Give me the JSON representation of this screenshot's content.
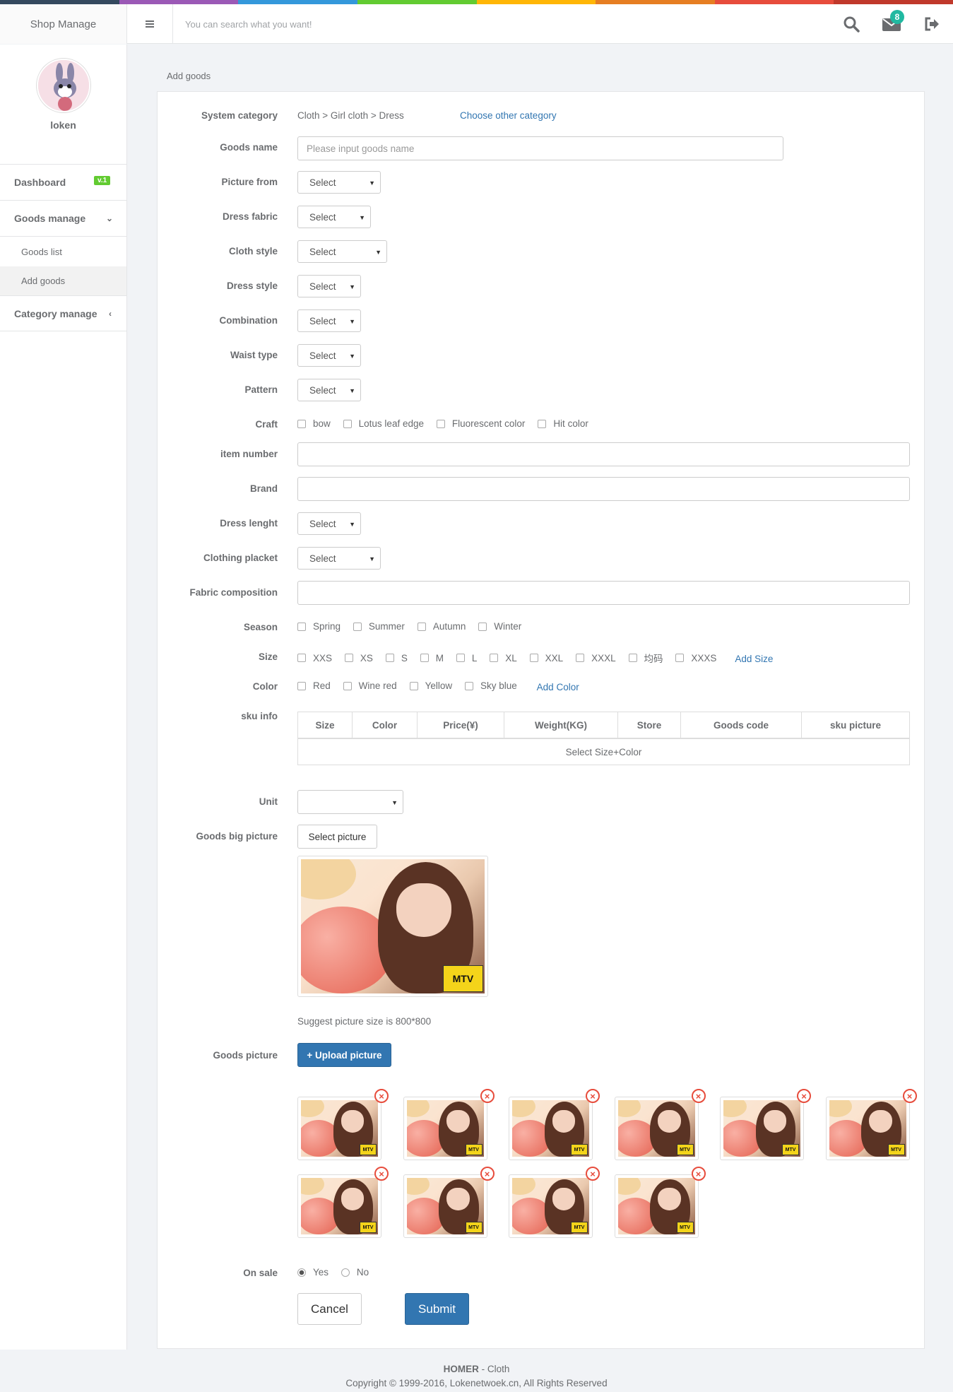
{
  "colors": [
    "#34495e",
    "#9b59b6",
    "#3498db",
    "#62cb31",
    "#ffb606",
    "#e67e22",
    "#e74c3c",
    "#c0392b"
  ],
  "header": {
    "brand": "Shop Manage",
    "search_placeholder": "You can search what you want!",
    "mail_count": "8",
    "icons": [
      "menu-icon",
      "search-icon",
      "envelope-icon",
      "logout-icon"
    ]
  },
  "sidebar": {
    "username": "loken",
    "dashboard": "Dashboard",
    "version_badge": "v.1",
    "goods_manage": "Goods manage",
    "goods_list": "Goods list",
    "add_goods": "Add goods",
    "category_manage": "Category manage"
  },
  "page": {
    "title": "Add goods"
  },
  "form": {
    "system_category_label": "System category",
    "system_category_value": "Cloth > Girl cloth > Dress",
    "choose_category": "Choose other category",
    "goods_name_label": "Goods name",
    "goods_name_placeholder": "Please input goods name",
    "picture_from_label": "Picture from",
    "dress_fabric_label": "Dress fabric",
    "cloth_style_label": "Cloth style",
    "dress_style_label": "Dress style",
    "combination_label": "Combination",
    "waist_type_label": "Waist type",
    "pattern_label": "Pattern",
    "select": "Select",
    "craft_label": "Craft",
    "craft_options": [
      "bow",
      "Lotus leaf edge",
      "Fluorescent color",
      "Hit color"
    ],
    "item_number_label": "item number",
    "brand_label": "Brand",
    "dress_length_label": "Dress lenght",
    "clothing_placket_label": "Clothing placket",
    "fabric_composition_label": "Fabric composition",
    "season_label": "Season",
    "season_options": [
      "Spring",
      "Summer",
      "Autumn",
      "Winter"
    ],
    "size_label": "Size",
    "size_options": [
      "XXS",
      "XS",
      "S",
      "M",
      "L",
      "XL",
      "XXL",
      "XXXL",
      "均码",
      "XXXS"
    ],
    "add_size": "Add Size",
    "color_label": "Color",
    "color_options": [
      "Red",
      "Wine red",
      "Yellow",
      "Sky blue"
    ],
    "add_color": "Add Color",
    "sku_label": "sku info",
    "sku_columns": [
      "Size",
      "Color",
      "Price(¥)",
      "Weight(KG)",
      "Store",
      "Goods code",
      "sku picture"
    ],
    "sku_empty": "Select Size+Color",
    "unit_label": "Unit",
    "unit_value": "",
    "big_picture_label": "Goods big picture",
    "select_picture": "Select picture",
    "suggest": "Suggest picture size is 800*800",
    "goods_picture_label": "Goods picture",
    "upload_picture": "+ Upload picture",
    "on_sale_label": "On sale",
    "on_sale_yes": "Yes",
    "on_sale_no": "No",
    "cancel": "Cancel",
    "submit": "Submit",
    "photo_logo": "MTV"
  },
  "footer": {
    "brand": "HOMER",
    "brand_suffix": " - Cloth",
    "copyright": "Copyright © 1999-2016, Lokenetwoek.cn, All Rights Reserved"
  }
}
